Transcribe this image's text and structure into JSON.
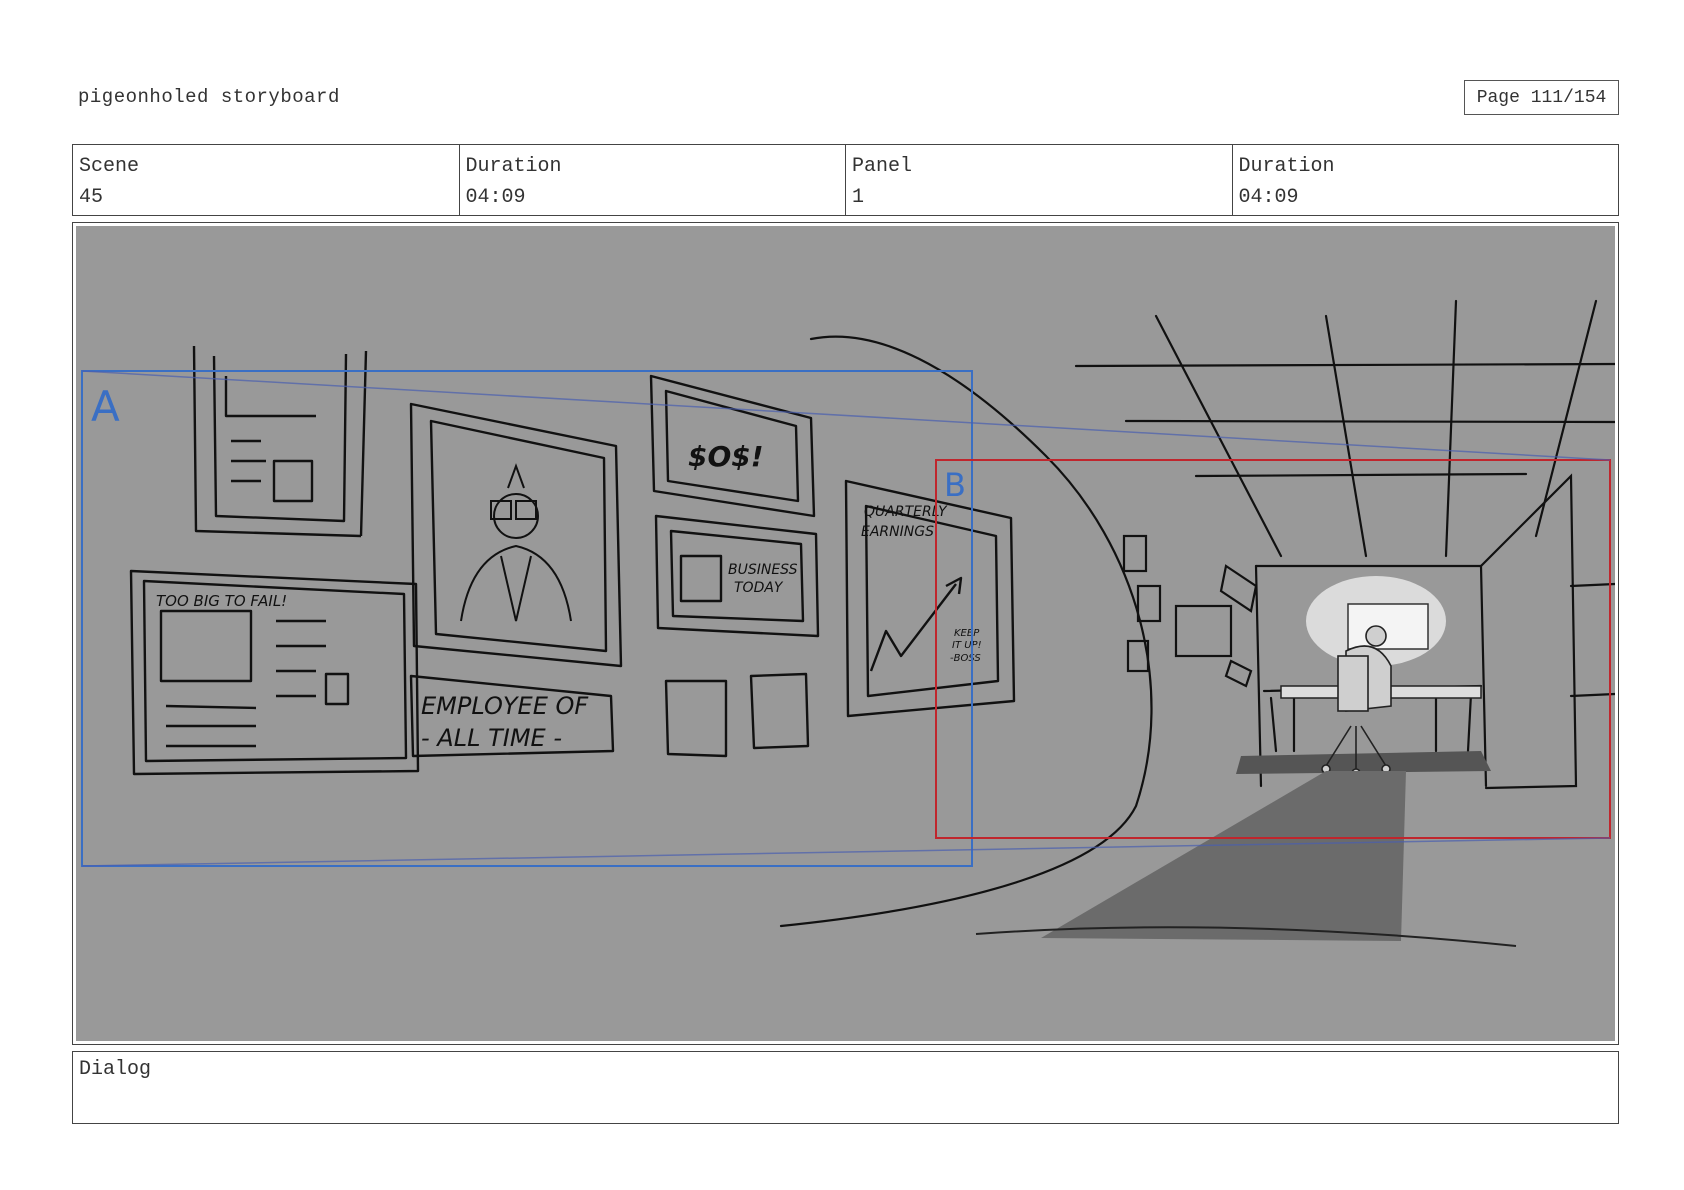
{
  "header": {
    "title": "pigeonholed storyboard",
    "page": "Page 111/154"
  },
  "info": {
    "scene_label": "Scene",
    "scene_value": "45",
    "duration_label": "Duration",
    "duration_value": "04:09",
    "panel_label": "Panel",
    "panel_value": "1",
    "panel_duration_label": "Duration",
    "panel_duration_value": "04:09"
  },
  "panel": {
    "frame_a_label": "A",
    "frame_b_label": "B",
    "sign_too_big": "TOO BIG TO FAIL!",
    "sign_money": "$O$!",
    "sign_business": "BUSINESS",
    "sign_today": "TODAY",
    "sign_earnings_1": "QUARTERLY",
    "sign_earnings_2": "EARNINGS",
    "sign_keep_1": "KEEP",
    "sign_keep_2": "IT UP!",
    "sign_keep_3": "-BOSS",
    "sign_employee_1": "EMPLOYEE OF",
    "sign_employee_2": "- ALL TIME -",
    "colors": {
      "background": "#999999",
      "frame_a": "#3a6fc4",
      "frame_b": "#c0262d",
      "shadow": "#6b6b6b"
    }
  },
  "dialog": {
    "label": "Dialog"
  }
}
